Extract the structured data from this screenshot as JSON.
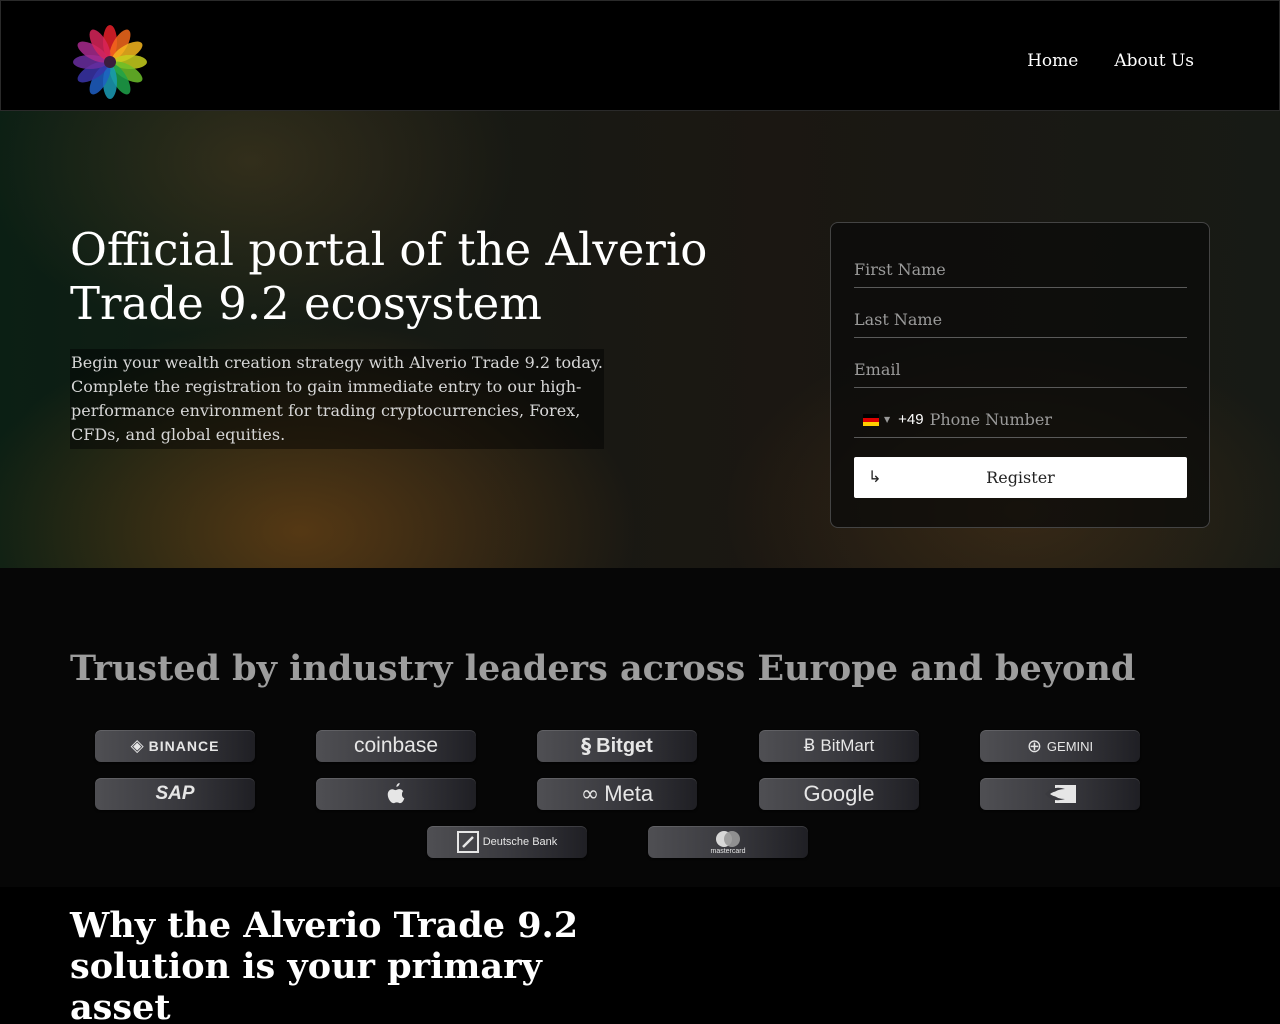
{
  "header": {
    "logo_icon": "lotus-flower-logo",
    "nav": [
      {
        "label": "Home"
      },
      {
        "label": "About Us"
      }
    ]
  },
  "hero": {
    "title": "Official portal of the Alverio Trade 9.2 ecosystem",
    "subtitle": "Begin your wealth creation strategy with Alverio Trade 9.2 today. Complete the registration to gain immediate entry to our high-performance environment for trading cryptocurrencies, Forex, CFDs, and global equities."
  },
  "form": {
    "first_name_placeholder": "First Name",
    "last_name_placeholder": "Last Name",
    "email_placeholder": "Email",
    "phone_country_flag": "germany-flag-icon",
    "phone_code": "+49",
    "phone_placeholder": "Phone Number",
    "register_icon": "arrow-return-icon",
    "register_label": "Register"
  },
  "trusted": {
    "title": "Trusted by industry leaders across Europe and beyond",
    "brands": [
      {
        "name": "BINANCE",
        "icon": "binance-icon"
      },
      {
        "name": "coinbase",
        "icon": ""
      },
      {
        "name": "Bitget",
        "icon": "bitget-icon"
      },
      {
        "name": "BitMart",
        "icon": "bitmart-icon"
      },
      {
        "name": "GEMINI",
        "icon": "gemini-icon"
      },
      {
        "name": "SAP",
        "icon": ""
      },
      {
        "name": "",
        "icon": "apple-icon"
      },
      {
        "name": "Meta",
        "icon": "meta-icon"
      },
      {
        "name": "Google",
        "icon": ""
      },
      {
        "name": "",
        "icon": "nvidia-icon"
      },
      {
        "name": "Deutsche Bank",
        "icon": "deutsche-bank-icon"
      },
      {
        "name": "mastercard",
        "icon": "mastercard-icon"
      }
    ]
  },
  "why": {
    "title": "Why the Alverio Trade 9.2 solution is your primary asset"
  },
  "colors": {
    "page_background": "#000000",
    "button_background": "#ffffff",
    "trusted_title": "#9d9d9d",
    "hero_accent": "#96551a"
  }
}
